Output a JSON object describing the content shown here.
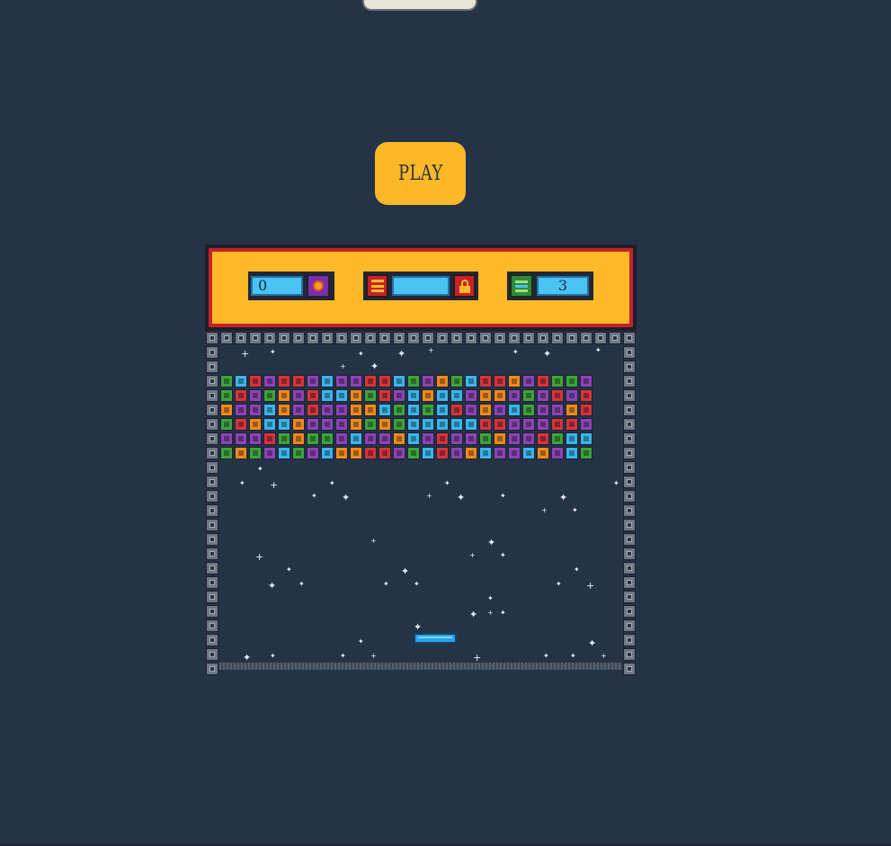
{
  "play_button": {
    "label": "PLAY"
  },
  "hud": {
    "score_value": "0",
    "lives_value": "3",
    "speed_value": "",
    "icons": [
      "sun-icon",
      "s-badge-icon",
      "lock-icon",
      "layers-icon"
    ]
  },
  "colors": {
    "background": "#253347",
    "hud_yellow": "#fdb928",
    "hud_red": "#c5222a",
    "field_blue": "#49c3f2",
    "paddle": "#22a7ea",
    "brick_green": "#3fa33c",
    "brick_blue": "#3bb6ea",
    "brick_red": "#d5353c",
    "brick_purple": "#8d44b5",
    "brick_orange": "#f08a1c"
  },
  "bricks": {
    "rows": [
      "GBRPRRPBPPRRBGPOGBRROPRGGP",
      "GRPGOPRBBOGRPBOBBPOOPGPRPR",
      "OPPBOPRPPOOBGBGBRPOPBGPPOR",
      "GROBBOPPPOGOGBBBBBRRPPPRRP",
      "PPPRGOGGPBPPOBPRPPGOPPRGBB",
      "GOGPBGPBOORRPGBRPOBPPBOPBG"
    ]
  }
}
